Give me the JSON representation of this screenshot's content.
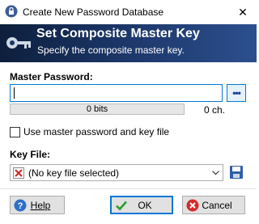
{
  "window": {
    "title": "Create New Password Database",
    "close_glyph": "✕"
  },
  "banner": {
    "title": "Set Composite Master Key",
    "subtitle": "Specify the composite master key.",
    "icon": "key-icon"
  },
  "master_password": {
    "label": "Master Password:",
    "value": "",
    "toggle_glyph": "•••",
    "quality_text": "0 bits",
    "char_count": "0 ch."
  },
  "key_file_option": {
    "label": "Use master password and key file",
    "checked": false
  },
  "key_file": {
    "label": "Key File:",
    "selected": "(No key file selected)",
    "icon": "no-key-file-icon",
    "save_icon": "save-icon"
  },
  "buttons": {
    "help": "Help",
    "ok": "OK",
    "cancel": "Cancel"
  },
  "colors": {
    "accent": "#0078d7",
    "banner_dark": "#0d1f3c",
    "banner_light": "#2c4f8e",
    "ok_check": "#2a9d2a",
    "cancel_x": "#d22b2b"
  }
}
